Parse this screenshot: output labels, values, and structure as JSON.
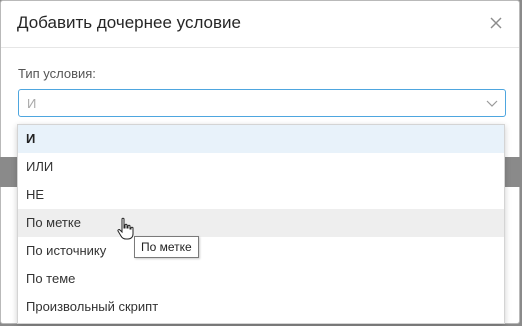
{
  "dialog": {
    "title": "Добавить дочернее условие",
    "close_icon": "close-icon"
  },
  "form": {
    "condition_type_label": "Тип условия:",
    "select_value": "И",
    "chevron_icon": "chevron-down-icon"
  },
  "dropdown": {
    "options": [
      {
        "label": "И",
        "state": "selected"
      },
      {
        "label": "ИЛИ",
        "state": "normal"
      },
      {
        "label": "НЕ",
        "state": "normal"
      },
      {
        "label": "По метке",
        "state": "hover"
      },
      {
        "label": "По источнику",
        "state": "normal"
      },
      {
        "label": "По теме",
        "state": "normal"
      },
      {
        "label": "Произвольный скрипт",
        "state": "normal"
      }
    ]
  },
  "tooltip": {
    "text": "По метке"
  },
  "colors": {
    "accent_border": "#4ea6df",
    "selected_bg": "#e8f2fa",
    "hover_bg": "#eeeeee"
  }
}
